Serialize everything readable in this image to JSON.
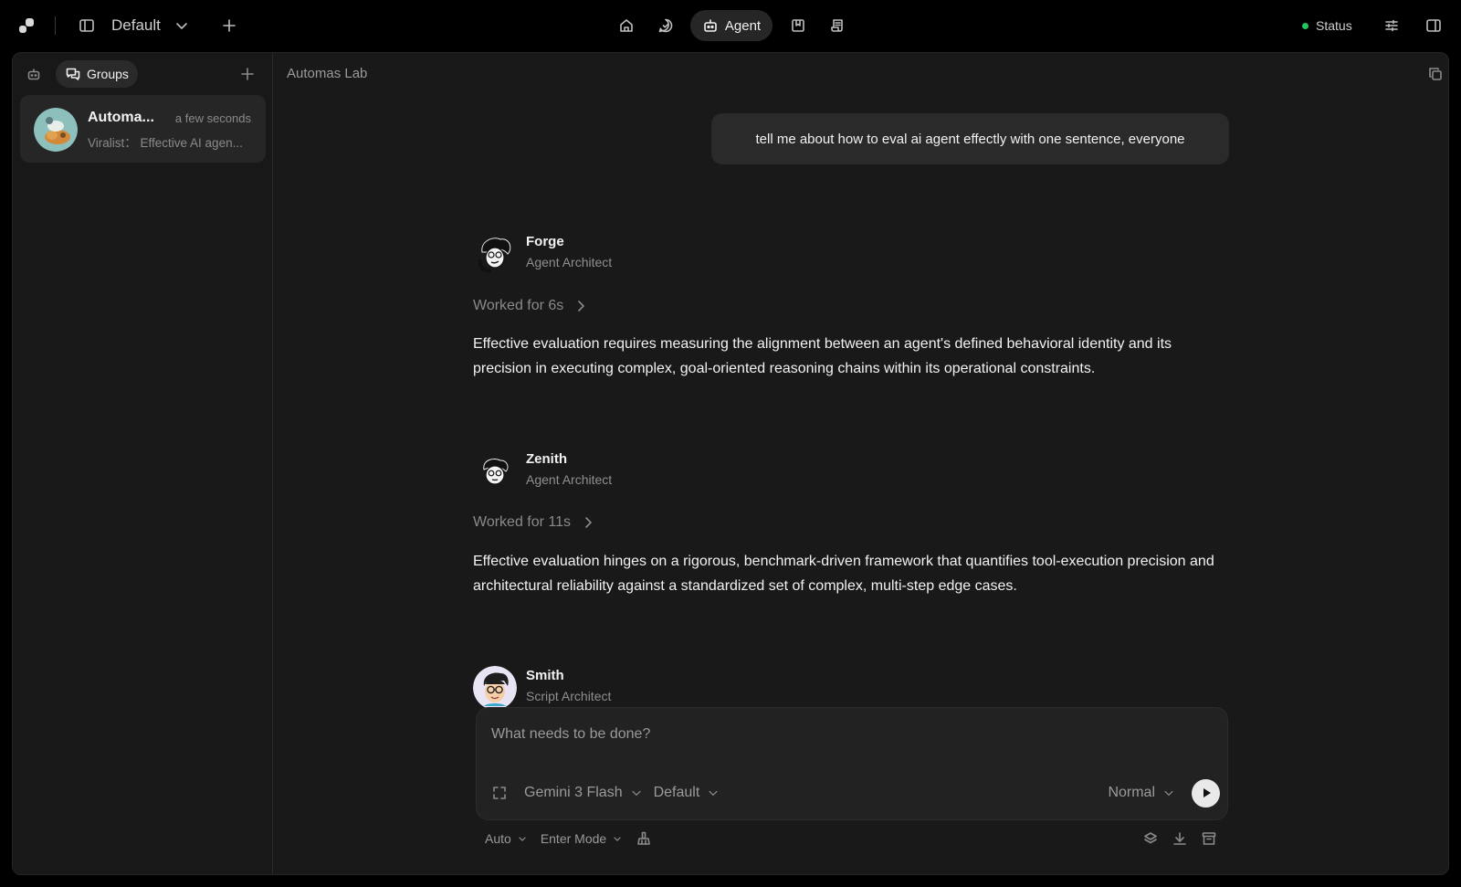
{
  "topbar": {
    "workspace": "Default",
    "agent_label": "Agent",
    "status_label": "Status"
  },
  "sidebar": {
    "groups_label": "Groups",
    "conversation": {
      "name": "Automa...",
      "time": "a few seconds",
      "preview": "Viralist： Effective AI agen..."
    }
  },
  "main": {
    "title": "Automas Lab",
    "user_message": "tell me about how to eval ai agent effectly with one sentence, everyone",
    "agents": [
      {
        "name": "Forge",
        "role": "Agent Architect",
        "worked": "Worked for 6s",
        "message": "Effective evaluation requires measuring the alignment between an agent's defined behavioral identity and its precision in executing complex, goal-oriented reasoning chains within its operational constraints."
      },
      {
        "name": "Zenith",
        "role": "Agent Architect",
        "worked": "Worked for 11s",
        "message": "Effective evaluation hinges on a rigorous, benchmark-driven framework that quantifies tool-execution precision and architectural reliability against a standardized set of complex, multi-step edge cases."
      },
      {
        "name": "Smith",
        "role": "Script Architect"
      }
    ]
  },
  "composer": {
    "placeholder": "What needs to be done?",
    "model": "Gemini 3 Flash",
    "preset": "Default",
    "mode": "Normal",
    "auto_label": "Auto",
    "enter_mode_label": "Enter Mode"
  },
  "colors": {
    "background": "#000000",
    "panel": "#191919",
    "status_dot": "#22c55e"
  }
}
